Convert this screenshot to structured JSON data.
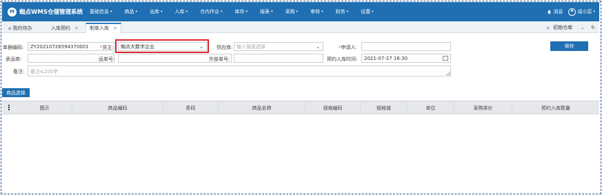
{
  "app": {
    "logo_letter": "M",
    "title": "蜘点WMS仓储管理系统"
  },
  "menu": [
    {
      "label": "基础信息"
    },
    {
      "label": "商品"
    },
    {
      "label": "出库"
    },
    {
      "label": "入库"
    },
    {
      "label": "仓内作业"
    },
    {
      "label": "库存"
    },
    {
      "label": "报表"
    },
    {
      "label": "采购"
    },
    {
      "label": "审核"
    },
    {
      "label": "财务"
    },
    {
      "label": "设置"
    }
  ],
  "user_area": {
    "messages": "消息",
    "user_name": "成小蕊"
  },
  "tabs": [
    {
      "label": "我的待办"
    },
    {
      "label": "入库预约"
    },
    {
      "label": "制单入库"
    }
  ],
  "warehouse": {
    "label": "初始仓库"
  },
  "form": {
    "doc_no": {
      "label": "单据编码:",
      "value": "ZY20210726594370001"
    },
    "owner": {
      "label": "货主:",
      "value": "蜘点大数字企业"
    },
    "supplier": {
      "label": "供应商:",
      "placeholder": "输入搜索选择"
    },
    "applicant": {
      "label": "申请人:",
      "value": ""
    },
    "carrier": {
      "label": "承运商:",
      "value": ""
    },
    "waybill": {
      "label": "运单号:",
      "value": ""
    },
    "external_no": {
      "label": "外部单号:",
      "value": ""
    },
    "appointment": {
      "label": "预约入库时间:",
      "value": "2021-07-27 16:30"
    },
    "remark": {
      "label": "备注:",
      "placeholder": "备注≤200字"
    }
  },
  "buttons": {
    "save": "保存",
    "select_goods": "商品选择"
  },
  "table": {
    "columns": [
      "图示",
      "商品编码",
      "条码",
      "商品名称",
      "规格编码",
      "规格值",
      "单位",
      "采购单价",
      "预约入库数量"
    ]
  }
}
